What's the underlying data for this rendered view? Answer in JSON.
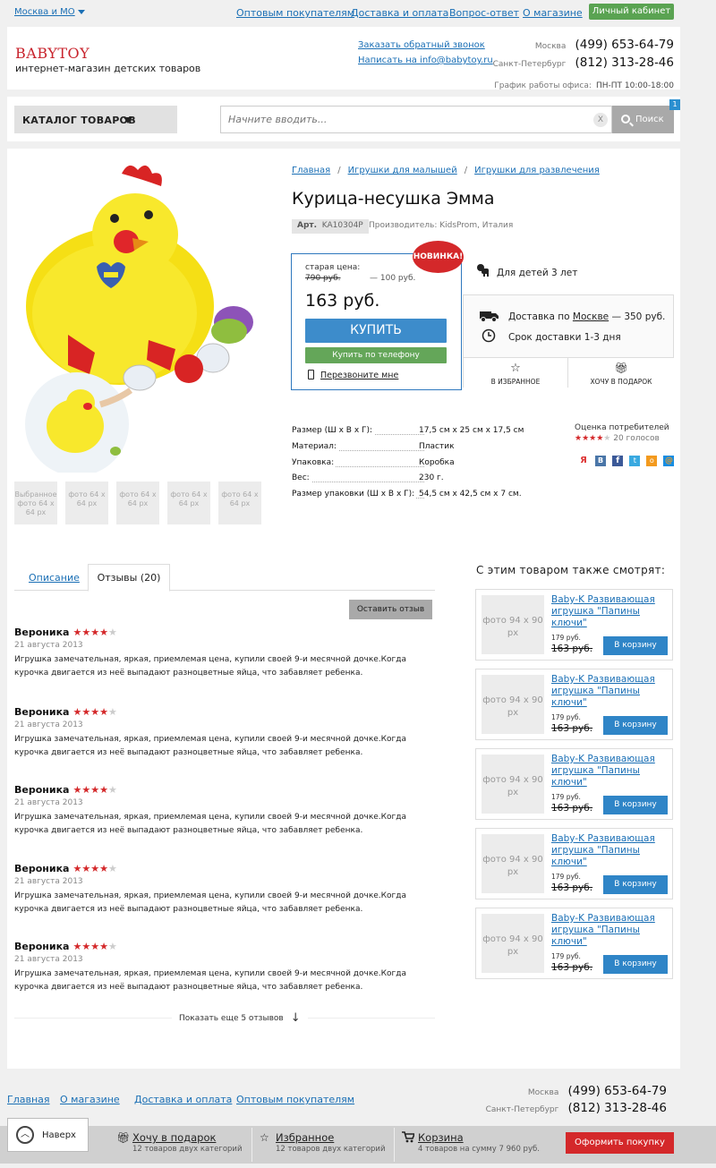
{
  "topbar": {
    "city": "Москва и МО",
    "links": [
      "Оптовым покупателям",
      "Доставка и оплата",
      "Вопрос-ответ",
      "О магазине"
    ],
    "cabinet": "Личный кабинет"
  },
  "header": {
    "logo": "BABYTOY",
    "tagline": "интернет-магазин детских товаров",
    "callback": "Заказать обратный звонок",
    "write": "Написать на info@babytoy.ru",
    "phones": [
      {
        "city": "Москва",
        "number": "(499) 653-64-79"
      },
      {
        "city": "Санкт-Петербург",
        "number": "(812) 313-28-46"
      }
    ],
    "hours_label": "График работы офиса:",
    "hours_value": "ПН-ПТ 10:00-18:00"
  },
  "search": {
    "catalog": "КАТАЛОГ ТОВАРОВ",
    "placeholder": "Начните вводить...",
    "clear": "X",
    "button": "Поиск",
    "cart_count": "1"
  },
  "product": {
    "breadcrumbs": [
      "Главная",
      "Игрушки для малышей",
      "Игрушки для развлечения"
    ],
    "title": "Курица-несушка Эмма",
    "art_label": "Арт.",
    "art_value": "KA10304P",
    "maker": "Производитель: KidsProm, Италия",
    "old_price_label": "старая цена:",
    "old_price": "790 руб.",
    "saving": "— 100 руб.",
    "price": "163 руб.",
    "buy": "КУПИТЬ",
    "buy_phone": "Купить по телефону",
    "callme": "Перезвоните мне",
    "badge": "НОВИНКА!",
    "age": "Для детей 3 лет",
    "delivery_prefix": "Доставка по",
    "delivery_city": "Москве",
    "delivery_suffix": "— 350 руб.",
    "delivery_time": "Срок доставки 1-3 дня",
    "favorite": "В ИЗБРАННОЕ",
    "gift": "ХОЧУ В ПОДАРОК",
    "thumb_selected": "Выбранное фото 64 x 64 px",
    "thumb": "фото 64 x 64 px",
    "specs": [
      {
        "k": "Размер (Ш х В х Г):",
        "v": "17,5 см х 25 см х 17,5 см"
      },
      {
        "k": "Материал:",
        "v": "Пластик"
      },
      {
        "k": "Упаковка:",
        "v": "Коробка"
      },
      {
        "k": "Вес:",
        "v": "230 г."
      },
      {
        "k": "Размер упаковки (Ш х В х Г):",
        "v": "54,5 см х 42,5 см х 7 см."
      }
    ],
    "rating_label": "Оценка потребителей",
    "rating_value": 4,
    "rating_votes": "20 голосов"
  },
  "tabs": {
    "description": "Описание",
    "reviews": "Отзывы (20)",
    "leave": "Оставить отзыв"
  },
  "reviews": [
    {
      "name": "Вероника",
      "stars": 4,
      "date": "21 августа 2013",
      "text": "Игрушка замечательная, яркая, приемлемая цена, купили своей 9-и месячной дочке.Когда курочка двигается из неё выпадают разноцветные яйца, что забавляет ребенка."
    },
    {
      "name": "Вероника",
      "stars": 4,
      "date": "21 августа 2013",
      "text": "Игрушка замечательная, яркая, приемлемая цена, купили своей 9-и месячной дочке.Когда курочка двигается из неё выпадают разноцветные яйца, что забавляет ребенка."
    },
    {
      "name": "Вероника",
      "stars": 4,
      "date": "21 августа 2013",
      "text": "Игрушка замечательная, яркая, приемлемая цена, купили своей 9-и месячной дочке.Когда курочка двигается из неё выпадают разноцветные яйца, что забавляет ребенка."
    },
    {
      "name": "Вероника",
      "stars": 4,
      "date": "21 августа 2013",
      "text": "Игрушка замечательная, яркая, приемлемая цена, купили своей 9-и месячной дочке.Когда курочка двигается из неё выпадают разноцветные яйца, что забавляет ребенка."
    },
    {
      "name": "Вероника",
      "stars": 4,
      "date": "21 августа 2013",
      "text": "Игрушка замечательная, яркая, приемлемая цена, купили своей 9-и месячной дочке.Когда курочка двигается из неё выпадают разноцветные яйца, что забавляет ребенка."
    }
  ],
  "more_reviews": "Показать еще 5 отзывов",
  "also": {
    "title": "С этим товаром также смотрят:",
    "items": [
      {
        "photo": "фото 94 x 90 px",
        "name": "Baby-K Развивающая игрушка \"Папины ключи\"",
        "price": "179 руб.",
        "old": "163 руб.",
        "button": "В корзину"
      },
      {
        "photo": "фото 94 x 90 px",
        "name": "Baby-K Развивающая игрушка \"Папины ключи\"",
        "price": "179 руб.",
        "old": "163 руб.",
        "button": "В корзину"
      },
      {
        "photo": "фото 94 x 90 px",
        "name": "Baby-K Развивающая игрушка \"Папины ключи\"",
        "price": "179 руб.",
        "old": "163 руб.",
        "button": "В корзину"
      },
      {
        "photo": "фото 94 x 90 px",
        "name": "Baby-K Развивающая игрушка \"Папины ключи\"",
        "price": "179 руб.",
        "old": "163 руб.",
        "button": "В корзину"
      },
      {
        "photo": "фото 94 x 90 px",
        "name": "Baby-K Развивающая игрушка \"Папины ключи\"",
        "price": "179 руб.",
        "old": "163 руб.",
        "button": "В корзину"
      }
    ]
  },
  "footer": {
    "links": [
      "Главная",
      "О магазине",
      "Доставка и оплата",
      "Оптовым покупателям"
    ],
    "phones": [
      {
        "city": "Москва",
        "number": "(499) 653-64-79"
      },
      {
        "city": "Санкт-Петербург",
        "number": "(812) 313-28-46"
      }
    ]
  },
  "bottombar": {
    "top": "Наверх",
    "gift_title": "Хочу в подарок",
    "gift_sub": "12 товаров двух категорий",
    "fav_title": "Избранное",
    "fav_sub": "12 товаров двух категорий",
    "cart_title": "Корзина",
    "cart_sub": "4 товаров на сумму 7 960 руб.",
    "order": "Оформить покупку"
  },
  "colors": {
    "accent": "#3d8ccb",
    "brand": "#c8232c",
    "green": "#5aa352",
    "sale": "#d4282a"
  }
}
